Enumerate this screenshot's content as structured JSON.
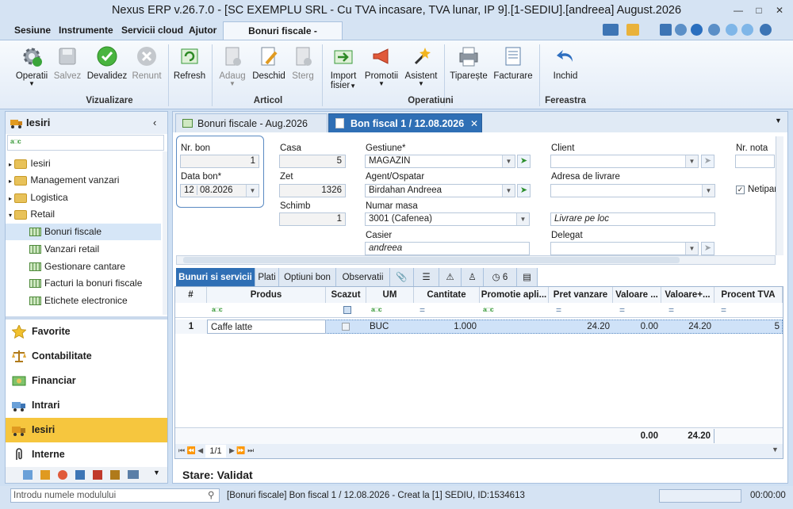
{
  "window": {
    "title": "Nexus ERP v.26.7.0 - [SC EXEMPLU SRL - Cu TVA incasare, TVA lunar, IP 9].[1-SEDIU].[andreea] August.2026"
  },
  "menu": {
    "items": [
      "Sesiune",
      "Instrumente",
      "Servicii cloud",
      "Ajutor"
    ],
    "active_tab": "Bonuri fiscale -  Modificare"
  },
  "ribbon": {
    "buttons": [
      {
        "label": "Operatii",
        "dropdown": true
      },
      {
        "label": "Salvez",
        "disabled": true
      },
      {
        "label": "Devalidez"
      },
      {
        "label": "Renunt",
        "disabled": true
      },
      {
        "label": "Refresh"
      },
      {
        "label": "Adaug",
        "disabled": true,
        "dropdown": true
      },
      {
        "label": "Deschid"
      },
      {
        "label": "Sterg",
        "disabled": true
      },
      {
        "label": "Import",
        "label2": "fisier",
        "dropdown": true
      },
      {
        "label": "Promotii",
        "dropdown": true
      },
      {
        "label": "Asistent",
        "dropdown": true
      },
      {
        "label": "Tiparește"
      },
      {
        "label": "Facturare"
      },
      {
        "label": "Inchid"
      }
    ],
    "groups": [
      "Vizualizare",
      "Articol",
      "Operatiuni",
      "Fereastra"
    ]
  },
  "left_panel": {
    "title": "Iesiri",
    "tree": [
      {
        "label": "Iesiri",
        "level": 0
      },
      {
        "label": "Management vanzari",
        "level": 0
      },
      {
        "label": "Logistica",
        "level": 0
      },
      {
        "label": "Retail",
        "level": 0,
        "open": true
      },
      {
        "label": "Bonuri fiscale",
        "level": 1,
        "selected": true
      },
      {
        "label": "Vanzari retail",
        "level": 1
      },
      {
        "label": "Gestionare cantare",
        "level": 1
      },
      {
        "label": "Facturi la bonuri fiscale",
        "level": 1
      },
      {
        "label": "Etichete electronice",
        "level": 1
      }
    ],
    "nav": [
      "Favorite",
      "Contabilitate",
      "Financiar",
      "Intrari",
      "Iesiri",
      "Interne"
    ],
    "nav_active": "Iesiri"
  },
  "doc_tabs": [
    {
      "label": "Bonuri fiscale - Aug.2026"
    },
    {
      "label": "Bon fiscal 1 / 12.08.2026",
      "active": true
    }
  ],
  "form": {
    "nr_bon_label": "Nr. bon",
    "nr_bon": "1",
    "data_bon_label": "Data bon*",
    "data_day": "12",
    "data_month": "08.2026",
    "casa_label": "Casa",
    "casa": "5",
    "zet_label": "Zet",
    "zet": "1326",
    "schimb_label": "Schimb",
    "schimb": "1",
    "gestiune_label": "Gestiune*",
    "gestiune": "MAGAZIN",
    "agent_label": "Agent/Ospatar",
    "agent": "Birdahan Andreea",
    "masa_label": "Numar masa",
    "masa": "3001 (Cafenea)",
    "casier_label": "Casier",
    "casier": "andreea",
    "client_label": "Client",
    "client": "",
    "adresa_label": "Adresa de livrare",
    "adresa": "",
    "livrare": "Livrare pe loc",
    "delegat_label": "Delegat",
    "delegat": "",
    "nr_nota_label": "Nr. nota",
    "netipar_label": "Netipar"
  },
  "sub_tabs": [
    "Bunuri si servicii",
    "Plati",
    "Optiuni bon",
    "Observatii",
    "6"
  ],
  "grid": {
    "columns": [
      "#",
      "Produs",
      "Scazut",
      "UM",
      "Cantitate",
      "Promotie apli...",
      "Pret vanzare",
      "Valoare ...",
      "Valoare+...",
      "Procent TVA"
    ],
    "rows": [
      {
        "n": "1",
        "produs": "Caffe latte",
        "um": "BUC",
        "cantitate": "1.000",
        "pret": "24.20",
        "valoare": "0.00",
        "valoare_tva": "24.20",
        "procent": "5"
      }
    ],
    "totals": {
      "valoare": "0.00",
      "valoare_tva": "24.20"
    },
    "pager": "1/1"
  },
  "stare": {
    "label": "Stare:",
    "value": "Validat"
  },
  "status": {
    "search_placeholder": "Introdu numele modulului",
    "message": "[Bonuri fiscale] Bon fiscal 1 / 12.08.2026 - Creat la [1] SEDIU, ID:1534613",
    "time": "00:00:00"
  }
}
